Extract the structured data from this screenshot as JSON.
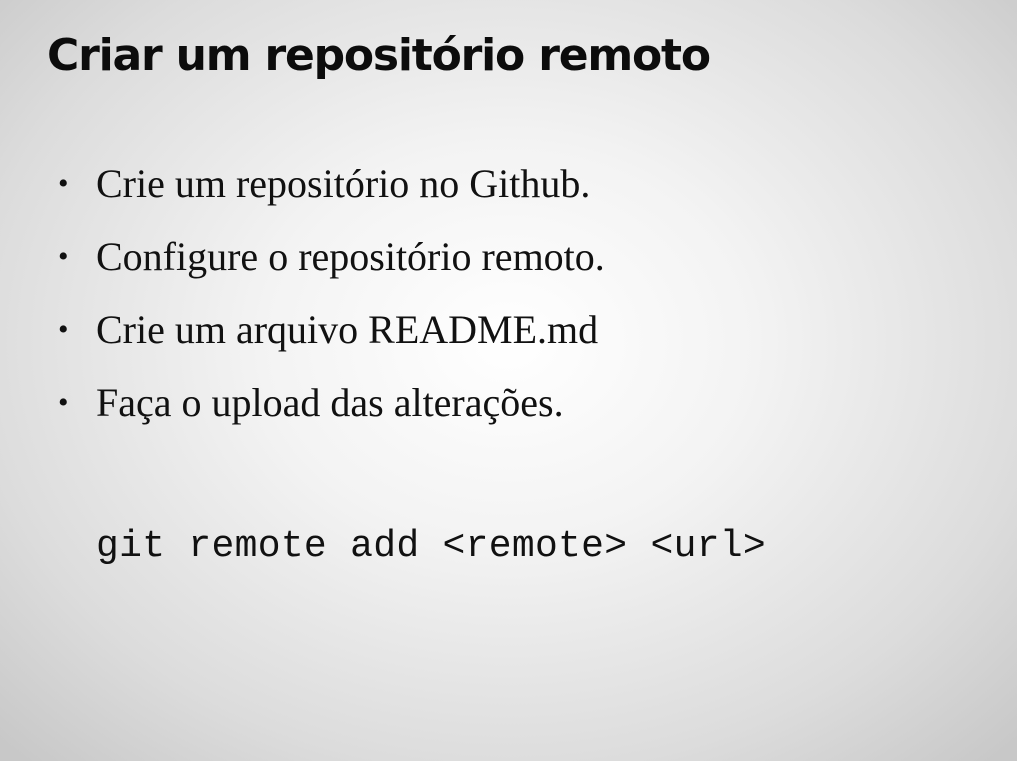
{
  "slide": {
    "title": "Criar um repositório remoto",
    "bullets": [
      "Crie um repositório no Github.",
      "Configure o repositório remoto.",
      "Crie um arquivo README.md",
      "Faça o upload das alterações."
    ],
    "bullet_symbol": "•",
    "code": "git remote add <remote> <url>"
  }
}
